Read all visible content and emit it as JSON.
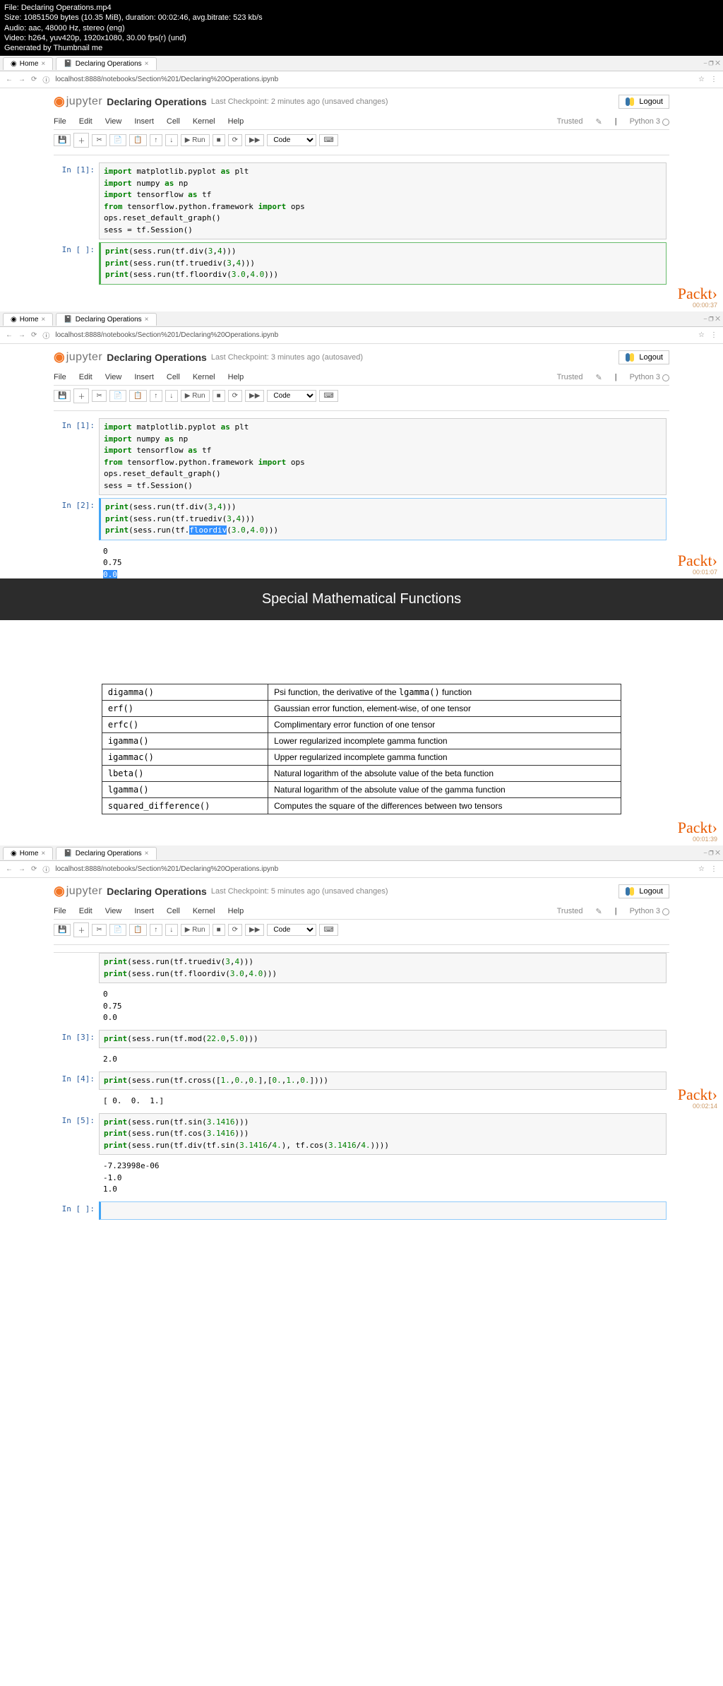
{
  "video_info": {
    "file": "File: Declaring Operations.mp4",
    "size": "Size: 10851509 bytes (10.35 MiB), duration: 00:02:46, avg.bitrate: 523 kb/s",
    "audio": "Audio: aac, 48000 Hz, stereo (eng)",
    "video": "Video: h264, yuv420p, 1920x1080, 30.00 fps(r) (und)",
    "gen": "Generated by Thumbnail me"
  },
  "browser": {
    "tab_home": "Home",
    "tab_doc": "Declaring Operations",
    "url": "localhost:8888/notebooks/Section%201/Declaring%20Operations.ipynb",
    "info_icon": "ⓘ"
  },
  "notebook": {
    "logo": "jupyter",
    "title": "Declaring Operations",
    "checkpoint1": "Last Checkpoint: 2 minutes ago  (unsaved changes)",
    "checkpoint2": "Last Checkpoint: 3 minutes ago  (autosaved)",
    "checkpoint3": "Last Checkpoint: 5 minutes ago  (unsaved changes)",
    "logout": "Logout",
    "trusted": "Trusted",
    "kernel": "Python 3",
    "menu": {
      "file": "File",
      "edit": "Edit",
      "view": "View",
      "insert": "Insert",
      "cell": "Cell",
      "kernel_m": "Kernel",
      "help": "Help"
    },
    "toolbar": {
      "run": "Run",
      "code": "Code"
    },
    "cells": {
      "in1_prompt": "In [1]:",
      "in_empty_prompt": "In [ ]:",
      "in2_prompt": "In [2]:",
      "in3_prompt": "In [3]:",
      "in4_prompt": "In [4]:",
      "in5_prompt": "In [5]:",
      "output2": "0\n0.75\n0.0",
      "output3": "2.0",
      "output4": "[ 0.  0.  1.]",
      "output5": "-7.23998e-06\n-1.0\n1.0",
      "output_partial": "0\n0.75\n0.0"
    }
  },
  "slide": {
    "title": "Special Mathematical Functions",
    "rows": [
      {
        "fn": "digamma()",
        "desc_pre": "Psi function, the derivative of the ",
        "desc_code": "lgamma()",
        "desc_post": " function"
      },
      {
        "fn": "erf()",
        "desc": "Gaussian error function, element-wise, of one tensor"
      },
      {
        "fn": "erfc()",
        "desc": "Complimentary error function of one tensor"
      },
      {
        "fn": "igamma()",
        "desc": "Lower regularized incomplete gamma function"
      },
      {
        "fn": "igammac()",
        "desc": "Upper regularized incomplete gamma function"
      },
      {
        "fn": "lbeta()",
        "desc": "Natural logarithm of the absolute value of the beta function"
      },
      {
        "fn": "lgamma()",
        "desc": "Natural logarithm of the absolute value of the gamma function"
      },
      {
        "fn": "squared_difference()",
        "desc": "Computes the square of the differences between two tensors"
      }
    ]
  },
  "watermark": {
    "brand": "Packt",
    "ts1": "00:00:37",
    "ts2": "00:01:07",
    "ts3": "00:01:39",
    "ts4": "00:02:14"
  },
  "win_controls": "⎯ ❐ ✕"
}
